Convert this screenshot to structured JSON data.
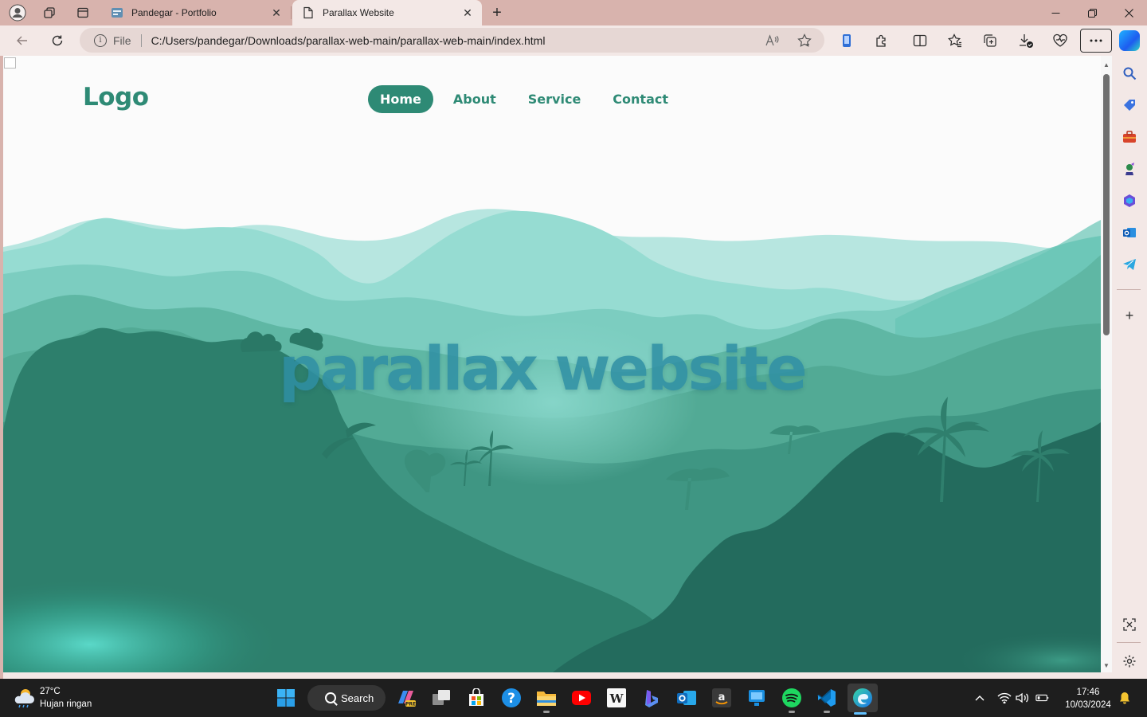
{
  "tabs": [
    {
      "title": "Pandegar - Portfolio",
      "active": false
    },
    {
      "title": "Parallax Website",
      "active": true
    }
  ],
  "address_bar": {
    "scheme_label": "File",
    "url": "C:/Users/pandegar/Downloads/parallax-web-main/parallax-web-main/index.html"
  },
  "toolbar_icons": [
    "read-aloud-icon",
    "favorite-star-icon",
    "phone-icon",
    "extensions-icon",
    "split-screen-icon",
    "favorites-icon",
    "collections-icon",
    "downloads-icon",
    "browser-essentials-icon",
    "more-icon",
    "copilot-icon"
  ],
  "site": {
    "logo": "Logo",
    "nav": [
      "Home",
      "About",
      "Service",
      "Contact"
    ],
    "active_nav": "Home",
    "hero_title": "parallax website"
  },
  "sidebar_icons": [
    "search-icon",
    "shopping-icon",
    "tools-icon",
    "games-icon",
    "microsoft-365-icon",
    "outlook-icon",
    "telegram-icon",
    "add-icon",
    "screenshot-icon",
    "settings-icon"
  ],
  "taskbar": {
    "weather": {
      "temp": "27°C",
      "condition": "Hujan ringan"
    },
    "search_label": "Search",
    "apps": [
      "windows-start",
      "search",
      "copilot-pre",
      "task-view",
      "microsoft-store",
      "get-help",
      "file-explorer",
      "youtube",
      "wikipedia",
      "bing-chat",
      "outlook",
      "amazon",
      "desktop-app",
      "spotify",
      "vscode",
      "edge"
    ],
    "time": "17:46",
    "date": "10/03/2024"
  },
  "colors": {
    "accent": "#2e8a75",
    "hero_text": "#2f8fa4",
    "tab_strip": "#d8b3ad",
    "toolbar": "#f3e8e6"
  }
}
